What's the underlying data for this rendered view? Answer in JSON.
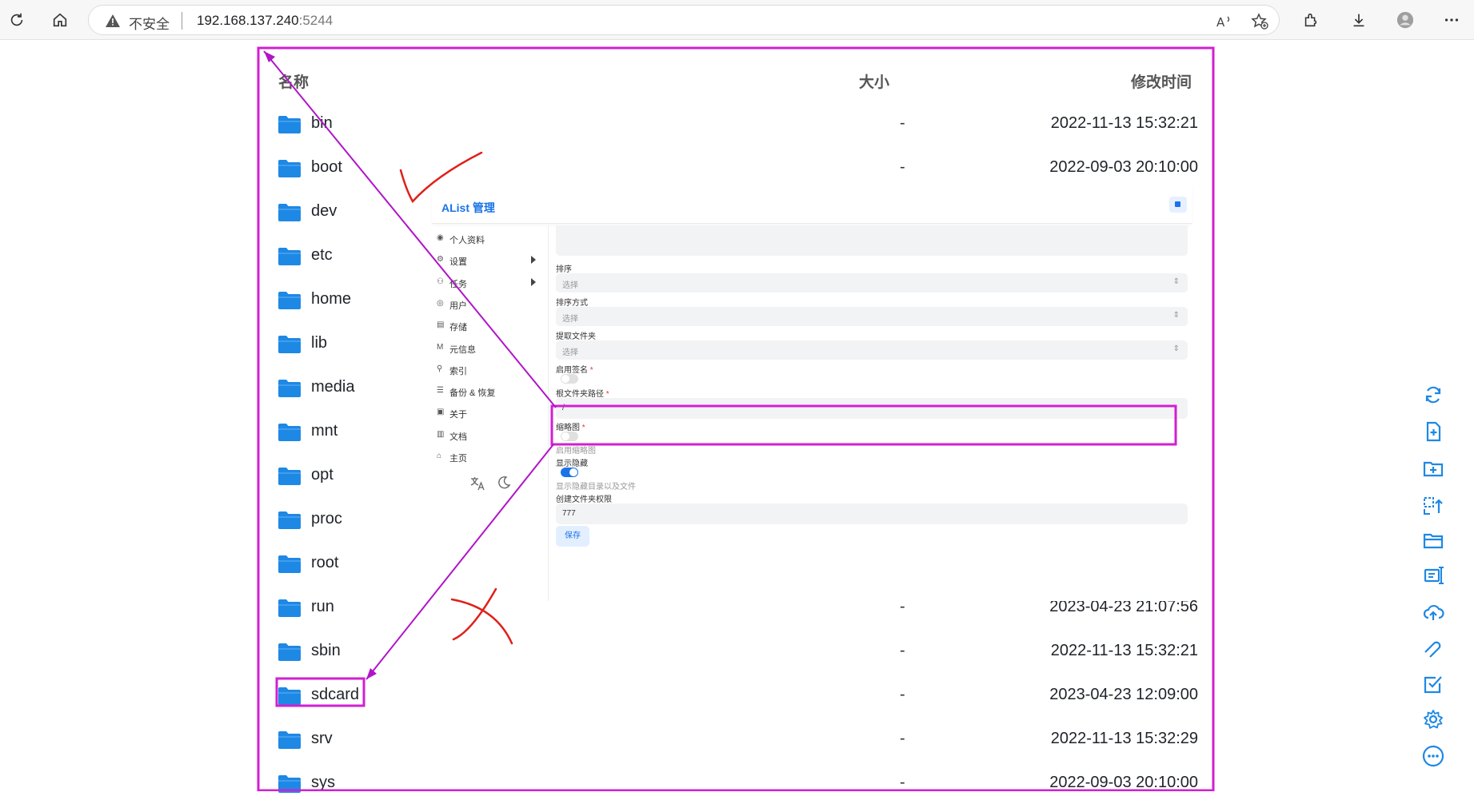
{
  "browser": {
    "insecure_label": "不安全",
    "url_host": "192.168.137.240",
    "url_port": ":5244"
  },
  "file_list": {
    "headers": {
      "name": "名称",
      "size": "大小",
      "modified": "修改时间"
    },
    "rows": [
      {
        "name": "bin",
        "size": "-",
        "modified": "2022-11-13 15:32:21"
      },
      {
        "name": "boot",
        "size": "-",
        "modified": "2022-09-03 20:10:00"
      },
      {
        "name": "dev",
        "size": "",
        "modified": ""
      },
      {
        "name": "etc",
        "size": "",
        "modified": ""
      },
      {
        "name": "home",
        "size": "",
        "modified": ""
      },
      {
        "name": "lib",
        "size": "",
        "modified": ""
      },
      {
        "name": "media",
        "size": "",
        "modified": ""
      },
      {
        "name": "mnt",
        "size": "",
        "modified": ""
      },
      {
        "name": "opt",
        "size": "",
        "modified": ""
      },
      {
        "name": "proc",
        "size": "",
        "modified": ""
      },
      {
        "name": "root",
        "size": "",
        "modified": ""
      },
      {
        "name": "run",
        "size": "-",
        "modified": "2023-04-23 21:07:56"
      },
      {
        "name": "sbin",
        "size": "-",
        "modified": "2022-11-13 15:32:21"
      },
      {
        "name": "sdcard",
        "size": "-",
        "modified": "2023-04-23 12:09:00"
      },
      {
        "name": "srv",
        "size": "-",
        "modified": "2022-11-13 15:32:29"
      },
      {
        "name": "sys",
        "size": "-",
        "modified": "2022-09-03 20:10:00"
      }
    ]
  },
  "admin": {
    "title": "AList 管理",
    "sidebar": [
      {
        "icon": "user-circle-icon",
        "glyph": "◉",
        "label": "个人资料",
        "has_arrow": false
      },
      {
        "icon": "gear-icon",
        "glyph": "⚙",
        "label": "设置",
        "has_arrow": true
      },
      {
        "icon": "tasks-icon",
        "glyph": "⚇",
        "label": "任务",
        "has_arrow": true
      },
      {
        "icon": "user-icon",
        "glyph": "◎",
        "label": "用户",
        "has_arrow": false
      },
      {
        "icon": "storage-icon",
        "glyph": "▤",
        "label": "存储",
        "has_arrow": false
      },
      {
        "icon": "metadata-icon",
        "glyph": "M",
        "label": "元信息",
        "has_arrow": false
      },
      {
        "icon": "search-icon",
        "glyph": "⚲",
        "label": "索引",
        "has_arrow": false
      },
      {
        "icon": "database-icon",
        "glyph": "☰",
        "label": "备份 & 恢复",
        "has_arrow": false
      },
      {
        "icon": "info-icon",
        "glyph": "▣",
        "label": "关于",
        "has_arrow": false
      },
      {
        "icon": "docs-icon",
        "glyph": "▥",
        "label": "文档",
        "has_arrow": false
      },
      {
        "icon": "home-icon",
        "glyph": "⌂",
        "label": "主页",
        "has_arrow": false
      }
    ],
    "form": {
      "order_label": "排序",
      "order_placeholder": "选择",
      "order_direction_label": "排序方式",
      "order_direction_placeholder": "选择",
      "extract_folder_label": "提取文件夹",
      "extract_folder_placeholder": "选择",
      "enable_sign_label": "启用签名",
      "root_folder_label": "根文件夹路径",
      "root_folder_value": "/",
      "thumbnail_label": "缩略图",
      "thumbnail_help": "启用缩略图",
      "show_hidden_label": "显示隐藏",
      "show_hidden_help": "显示隐藏目录以及文件",
      "mkdir_perm_label": "创建文件夹权限",
      "mkdir_perm_value": "777",
      "save_label": "保存",
      "required_mark": "*"
    }
  },
  "annotations": {
    "color_box": "#d21fd2",
    "color_mark": "#e0201a"
  },
  "colors": {
    "folder": "#1e88e5",
    "accent": "#1a73e8"
  }
}
